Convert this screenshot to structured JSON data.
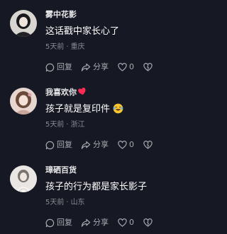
{
  "comments": [
    {
      "username": "雾中花影",
      "text": "这话戳中家长心了",
      "time": "5天前",
      "location": "重庆",
      "reply_label": "回复",
      "share_label": "分享",
      "like_count": "0",
      "avatar_icon": "user-avatar"
    },
    {
      "username": "我喜欢你",
      "username_badge": "heart-icon",
      "text": "孩子就是复印件",
      "emoji": "laughing-tears-emoji",
      "time": "5天前",
      "location": "浙江",
      "reply_label": "回复",
      "share_label": "分享",
      "like_count": "0",
      "avatar_icon": "user-avatar"
    },
    {
      "username": "璋硒百货",
      "text": "孩子的行为都是家长影子",
      "time": "5天前",
      "location": "山东",
      "reply_label": "回复",
      "share_label": "分享",
      "like_count": "0",
      "avatar_icon": "user-avatar"
    }
  ],
  "colors": {
    "background": "#161823",
    "meta_text": "#8a8b93",
    "badge_heart": "#fe2c55"
  }
}
